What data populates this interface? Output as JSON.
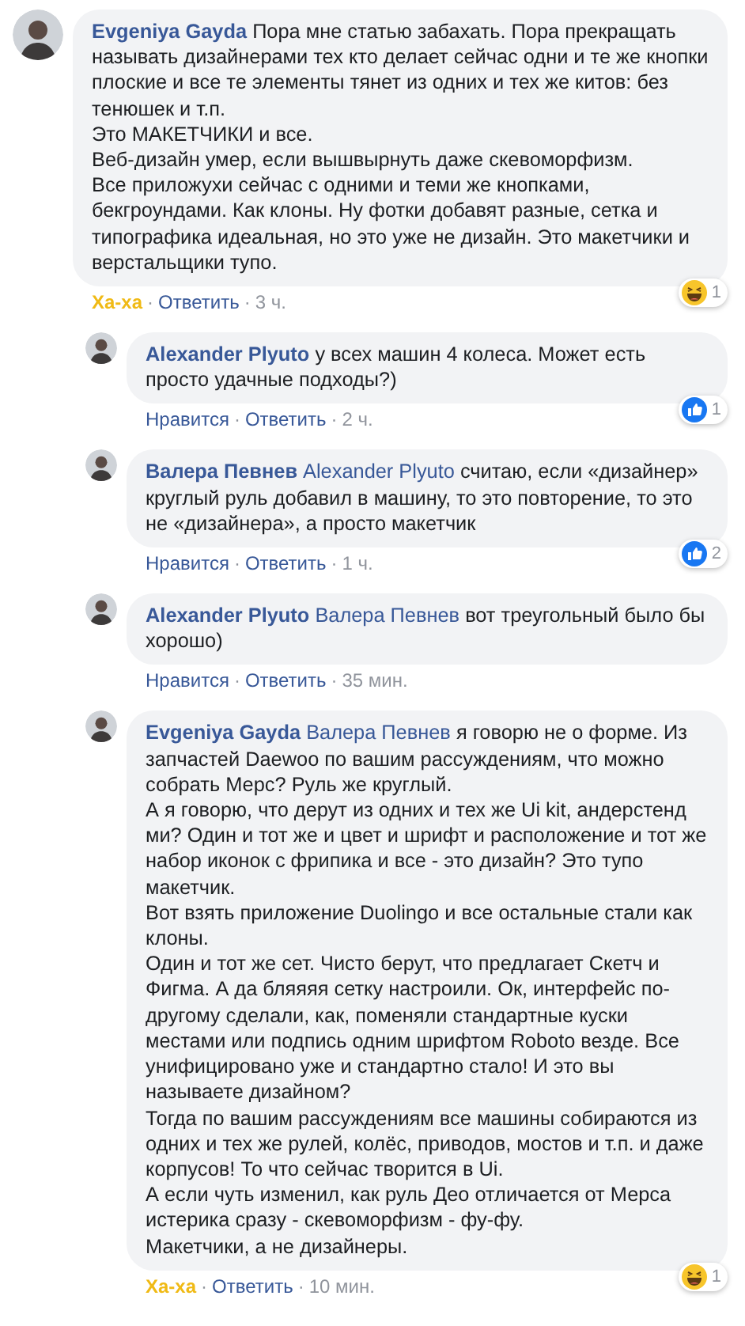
{
  "comments": [
    {
      "author": "Evgeniya Gayda",
      "text": "Пора мне статью забахать. Пора прекращать называть дизайнерами тех кто делает сейчас одни и те же кнопки плоские и все те элементы тянет из одних и тех же китов: без тенюшек и т.п.\nЭто МАКЕТЧИКИ и все.\nВеб-дизайн умер, если вышвырнуть даже скевоморфизм.\nВсе приложухи сейчас с одними и теми же кнопками, бекгроундами. Как клоны. Ну фотки добавят разные, сетка и типографика идеальная, но это уже не дизайн. Это макетчики и верстальщики тупо.",
      "reaction_action": {
        "label": "Ха-ха",
        "reacted": true
      },
      "reply": "Ответить",
      "separators": [
        "·",
        "·"
      ],
      "time": "3 ч.",
      "reactions": {
        "kind": "haha",
        "count": "1"
      },
      "replies": [
        {
          "author": "Alexander Plyuto",
          "text": "у всех машин 4 колеса. Может есть просто удачные подходы?)",
          "reaction_action": {
            "label": "Нравится",
            "reacted": false
          },
          "reply": "Ответить",
          "separators": [
            "·",
            "·"
          ],
          "time": "2 ч.",
          "reactions": {
            "kind": "like",
            "count": "1"
          }
        },
        {
          "author": "Валера Певнев",
          "mention": "Alexander Plyuto",
          "text": "считаю, если «дизайнер» круглый руль добавил в машину, то это повторение, то это не «дизайнера», а просто макетчик",
          "reaction_action": {
            "label": "Нравится",
            "reacted": false
          },
          "reply": "Ответить",
          "separators": [
            "·",
            "·"
          ],
          "time": "1 ч.",
          "reactions": {
            "kind": "like",
            "count": "2"
          }
        },
        {
          "author": "Alexander Plyuto",
          "mention": "Валера Певнев",
          "text": "вот треугольный было бы хорошо)",
          "reaction_action": {
            "label": "Нравится",
            "reacted": false
          },
          "reply": "Ответить",
          "separators": [
            "·",
            "·"
          ],
          "time": "35 мин."
        },
        {
          "author": "Evgeniya Gayda",
          "mention": "Валера Певнев",
          "text": "я говорю не о форме. Из запчастей Daewoo по вашим рассуждениям, что можно собрать Мерс? Руль же круглый.\nА я говорю, что дерут из одних и тех же Ui kit, андерстенд ми? Один и тот же и цвет и шрифт и расположение и тот же набор иконок с фрипика и все - это дизайн? Это тупо макетчик.\nВот взять приложение Duolingo и все остальные стали как клоны.\nОдин и тот же сет. Чисто берут, что предлагает Скетч и Фигма. А да бляяяя сетку настроили. Ок, интерфейс по-другому сделали, как, поменяли стандартные куски местами или подпись одним шрифтом Roboto везде. Все унифицировано уже и стандартно стало! И это вы называете дизайном?\nТогда по вашим рассуждениям все машины собираются из одних и тех же рулей, колёс, приводов, мостов и т.п. и даже корпусов! То что сейчас творится в Ui.\nА если чуть изменил, как руль Део отличается от Мерса истерика сразу - скевоморфизм - фу-фу.\nМакетчики, а не дизайнеры.",
          "reaction_action": {
            "label": "Ха-ха",
            "reacted": true
          },
          "reply": "Ответить",
          "separators": [
            "·",
            "·"
          ],
          "time": "10 мин.",
          "reactions": {
            "kind": "haha",
            "count": "1"
          }
        }
      ]
    }
  ]
}
